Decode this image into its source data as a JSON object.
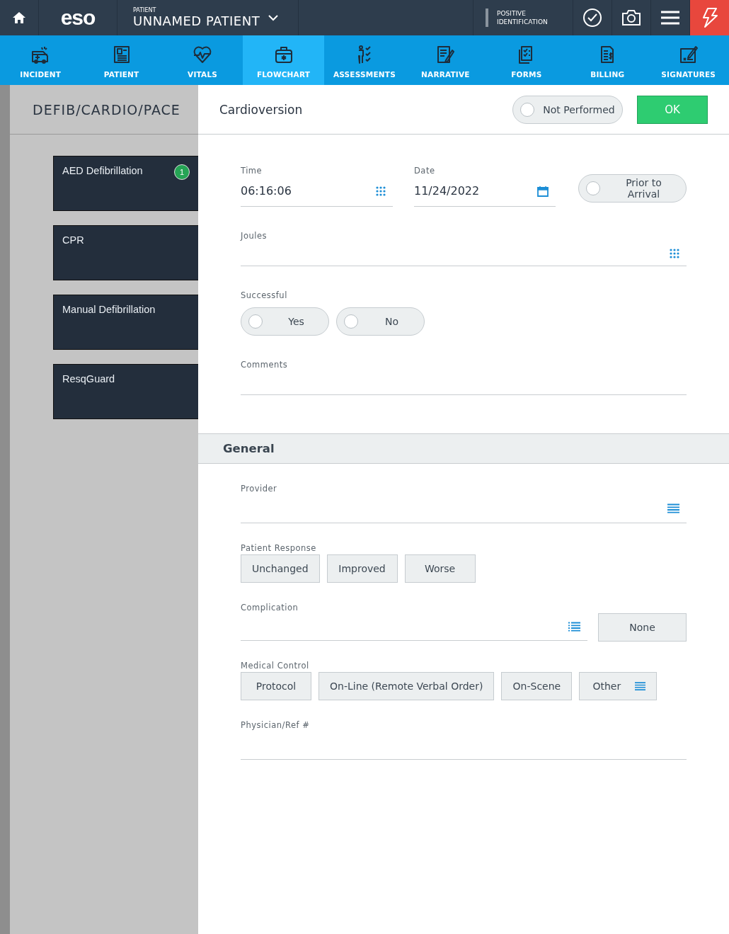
{
  "topbar": {
    "logo": "eso",
    "patient_caption": "PATIENT",
    "patient_name": "UNNAMED PATIENT",
    "identification": "POSITIVE IDENTIFICATION"
  },
  "nav_tabs": [
    {
      "label": "INCIDENT",
      "selected": false
    },
    {
      "label": "PATIENT",
      "selected": false
    },
    {
      "label": "VITALS",
      "selected": false
    },
    {
      "label": "FLOWCHART",
      "selected": true
    },
    {
      "label": "ASSESSMENTS",
      "selected": false
    },
    {
      "label": "NARRATIVE",
      "selected": false
    },
    {
      "label": "FORMS",
      "selected": false
    },
    {
      "label": "BILLING",
      "selected": false
    },
    {
      "label": "SIGNATURES",
      "selected": false
    }
  ],
  "sidebar": {
    "title": "DEFIB/CARDIO/PACE",
    "items": [
      {
        "label": "AED Defibrillation",
        "badge": "1"
      },
      {
        "label": "CPR"
      },
      {
        "label": "Manual Defibrillation"
      },
      {
        "label": "ResqGuard"
      }
    ]
  },
  "procedure": {
    "title": "Cardioversion",
    "not_performed": {
      "label": "Not Performed",
      "selected": false
    },
    "ok_button": "OK"
  },
  "cardioversion": {
    "time": {
      "label": "Time",
      "value": "06:16:06"
    },
    "date": {
      "label": "Date",
      "value": "11/24/2022"
    },
    "prior_to_arrival": {
      "label": "Prior to Arrival",
      "selected": false
    },
    "joules": {
      "label": "Joules"
    },
    "successful": {
      "label": "Successful",
      "options": [
        {
          "label": "Yes",
          "selected": false
        },
        {
          "label": "No",
          "selected": false
        }
      ]
    },
    "comments": {
      "label": "Comments"
    }
  },
  "general": {
    "title": "General",
    "provider": {
      "label": "Provider"
    },
    "patient_response": {
      "label": "Patient Response",
      "options": [
        {
          "label": "Unchanged",
          "selected": false
        },
        {
          "label": "Improved",
          "selected": false
        },
        {
          "label": "Worse",
          "selected": false
        }
      ]
    },
    "complication": {
      "label": "Complication",
      "none_button": {
        "label": "None",
        "selected": false
      }
    },
    "medical_control": {
      "label": "Medical Control",
      "options": [
        {
          "label": "Protocol",
          "selected": false,
          "kind": "plain"
        },
        {
          "label": "On-Line (Remote Verbal Order)",
          "selected": false,
          "kind": "plain"
        },
        {
          "label": "On-Scene",
          "selected": false,
          "kind": "plain"
        },
        {
          "label": "Other",
          "selected": false,
          "kind": "menu"
        }
      ]
    },
    "physician": {
      "label": "Physician/Ref #"
    }
  }
}
